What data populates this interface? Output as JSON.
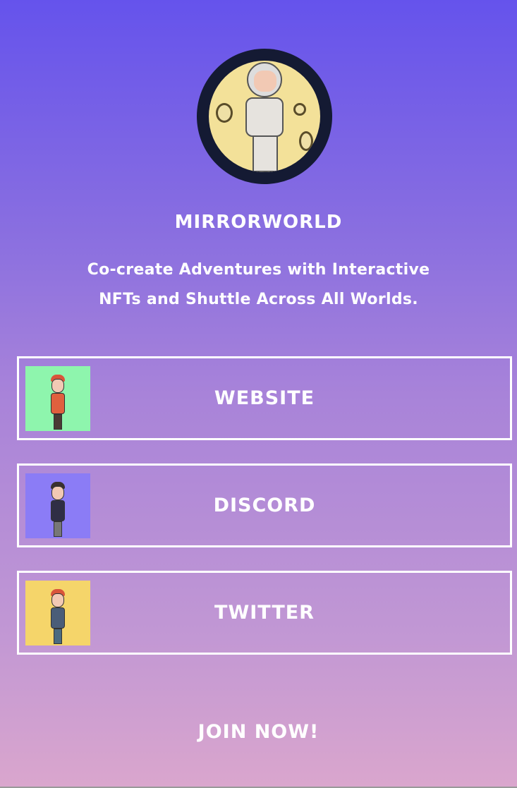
{
  "profile": {
    "name": "MIRRORWORLD",
    "description_line1": "Co-create Adventures with Interactive",
    "description_line2": "NFTs and Shuttle Across All Worlds."
  },
  "links": [
    {
      "label": "WEBSITE",
      "thumb_color": "#8ef5ad"
    },
    {
      "label": "DISCORD",
      "thumb_color": "#8b7cf6"
    },
    {
      "label": "TWITTER",
      "thumb_color": "#f5d56a"
    }
  ],
  "footer": {
    "cta": "JOIN NOW!"
  }
}
